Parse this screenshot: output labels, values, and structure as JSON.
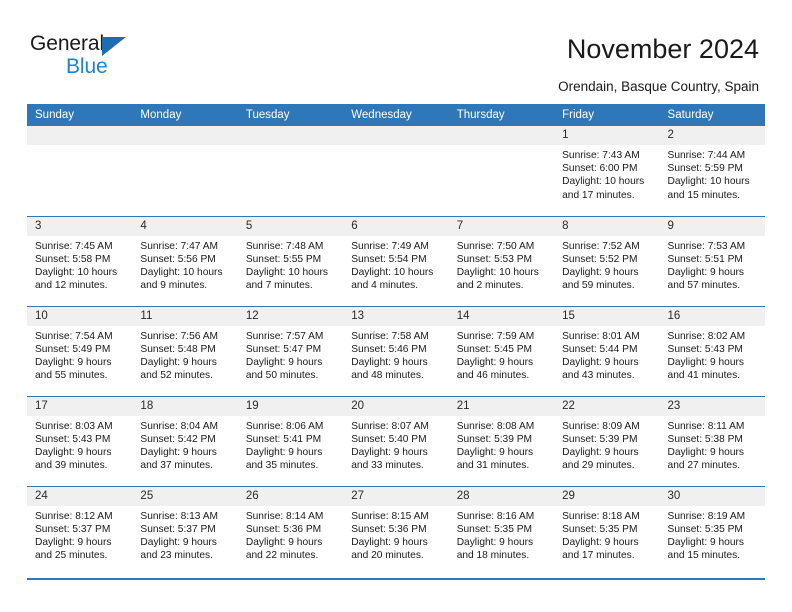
{
  "brand": {
    "name_part1": "General",
    "name_part2": "Blue",
    "triangle_color": "#1f6cb4",
    "blue_text_color": "#1f81d6"
  },
  "header": {
    "title": "November 2024",
    "location": "Orendain, Basque Country, Spain"
  },
  "theme": {
    "accent": "#2e77b8",
    "header_text": "#ffffff",
    "datenum_band": "#f0f0f0",
    "body_text": "#1a1a1a"
  },
  "weekday_headers": [
    "Sunday",
    "Monday",
    "Tuesday",
    "Wednesday",
    "Thursday",
    "Friday",
    "Saturday"
  ],
  "labels": {
    "sunrise_prefix": "Sunrise:",
    "sunset_prefix": "Sunset:",
    "daylight_prefix": "Daylight:"
  },
  "weeks": [
    [
      {
        "empty": true
      },
      {
        "empty": true
      },
      {
        "empty": true
      },
      {
        "empty": true
      },
      {
        "empty": true
      },
      {
        "day": "1",
        "line1": "Sunrise: 7:43 AM",
        "line2": "Sunset: 6:00 PM",
        "line3": "Daylight: 10 hours",
        "line4": "and 17 minutes."
      },
      {
        "day": "2",
        "line1": "Sunrise: 7:44 AM",
        "line2": "Sunset: 5:59 PM",
        "line3": "Daylight: 10 hours",
        "line4": "and 15 minutes."
      }
    ],
    [
      {
        "day": "3",
        "line1": "Sunrise: 7:45 AM",
        "line2": "Sunset: 5:58 PM",
        "line3": "Daylight: 10 hours",
        "line4": "and 12 minutes."
      },
      {
        "day": "4",
        "line1": "Sunrise: 7:47 AM",
        "line2": "Sunset: 5:56 PM",
        "line3": "Daylight: 10 hours",
        "line4": "and 9 minutes."
      },
      {
        "day": "5",
        "line1": "Sunrise: 7:48 AM",
        "line2": "Sunset: 5:55 PM",
        "line3": "Daylight: 10 hours",
        "line4": "and 7 minutes."
      },
      {
        "day": "6",
        "line1": "Sunrise: 7:49 AM",
        "line2": "Sunset: 5:54 PM",
        "line3": "Daylight: 10 hours",
        "line4": "and 4 minutes."
      },
      {
        "day": "7",
        "line1": "Sunrise: 7:50 AM",
        "line2": "Sunset: 5:53 PM",
        "line3": "Daylight: 10 hours",
        "line4": "and 2 minutes."
      },
      {
        "day": "8",
        "line1": "Sunrise: 7:52 AM",
        "line2": "Sunset: 5:52 PM",
        "line3": "Daylight: 9 hours",
        "line4": "and 59 minutes."
      },
      {
        "day": "9",
        "line1": "Sunrise: 7:53 AM",
        "line2": "Sunset: 5:51 PM",
        "line3": "Daylight: 9 hours",
        "line4": "and 57 minutes."
      }
    ],
    [
      {
        "day": "10",
        "line1": "Sunrise: 7:54 AM",
        "line2": "Sunset: 5:49 PM",
        "line3": "Daylight: 9 hours",
        "line4": "and 55 minutes."
      },
      {
        "day": "11",
        "line1": "Sunrise: 7:56 AM",
        "line2": "Sunset: 5:48 PM",
        "line3": "Daylight: 9 hours",
        "line4": "and 52 minutes."
      },
      {
        "day": "12",
        "line1": "Sunrise: 7:57 AM",
        "line2": "Sunset: 5:47 PM",
        "line3": "Daylight: 9 hours",
        "line4": "and 50 minutes."
      },
      {
        "day": "13",
        "line1": "Sunrise: 7:58 AM",
        "line2": "Sunset: 5:46 PM",
        "line3": "Daylight: 9 hours",
        "line4": "and 48 minutes."
      },
      {
        "day": "14",
        "line1": "Sunrise: 7:59 AM",
        "line2": "Sunset: 5:45 PM",
        "line3": "Daylight: 9 hours",
        "line4": "and 46 minutes."
      },
      {
        "day": "15",
        "line1": "Sunrise: 8:01 AM",
        "line2": "Sunset: 5:44 PM",
        "line3": "Daylight: 9 hours",
        "line4": "and 43 minutes."
      },
      {
        "day": "16",
        "line1": "Sunrise: 8:02 AM",
        "line2": "Sunset: 5:43 PM",
        "line3": "Daylight: 9 hours",
        "line4": "and 41 minutes."
      }
    ],
    [
      {
        "day": "17",
        "line1": "Sunrise: 8:03 AM",
        "line2": "Sunset: 5:43 PM",
        "line3": "Daylight: 9 hours",
        "line4": "and 39 minutes."
      },
      {
        "day": "18",
        "line1": "Sunrise: 8:04 AM",
        "line2": "Sunset: 5:42 PM",
        "line3": "Daylight: 9 hours",
        "line4": "and 37 minutes."
      },
      {
        "day": "19",
        "line1": "Sunrise: 8:06 AM",
        "line2": "Sunset: 5:41 PM",
        "line3": "Daylight: 9 hours",
        "line4": "and 35 minutes."
      },
      {
        "day": "20",
        "line1": "Sunrise: 8:07 AM",
        "line2": "Sunset: 5:40 PM",
        "line3": "Daylight: 9 hours",
        "line4": "and 33 minutes."
      },
      {
        "day": "21",
        "line1": "Sunrise: 8:08 AM",
        "line2": "Sunset: 5:39 PM",
        "line3": "Daylight: 9 hours",
        "line4": "and 31 minutes."
      },
      {
        "day": "22",
        "line1": "Sunrise: 8:09 AM",
        "line2": "Sunset: 5:39 PM",
        "line3": "Daylight: 9 hours",
        "line4": "and 29 minutes."
      },
      {
        "day": "23",
        "line1": "Sunrise: 8:11 AM",
        "line2": "Sunset: 5:38 PM",
        "line3": "Daylight: 9 hours",
        "line4": "and 27 minutes."
      }
    ],
    [
      {
        "day": "24",
        "line1": "Sunrise: 8:12 AM",
        "line2": "Sunset: 5:37 PM",
        "line3": "Daylight: 9 hours",
        "line4": "and 25 minutes."
      },
      {
        "day": "25",
        "line1": "Sunrise: 8:13 AM",
        "line2": "Sunset: 5:37 PM",
        "line3": "Daylight: 9 hours",
        "line4": "and 23 minutes."
      },
      {
        "day": "26",
        "line1": "Sunrise: 8:14 AM",
        "line2": "Sunset: 5:36 PM",
        "line3": "Daylight: 9 hours",
        "line4": "and 22 minutes."
      },
      {
        "day": "27",
        "line1": "Sunrise: 8:15 AM",
        "line2": "Sunset: 5:36 PM",
        "line3": "Daylight: 9 hours",
        "line4": "and 20 minutes."
      },
      {
        "day": "28",
        "line1": "Sunrise: 8:16 AM",
        "line2": "Sunset: 5:35 PM",
        "line3": "Daylight: 9 hours",
        "line4": "and 18 minutes."
      },
      {
        "day": "29",
        "line1": "Sunrise: 8:18 AM",
        "line2": "Sunset: 5:35 PM",
        "line3": "Daylight: 9 hours",
        "line4": "and 17 minutes."
      },
      {
        "day": "30",
        "line1": "Sunrise: 8:19 AM",
        "line2": "Sunset: 5:35 PM",
        "line3": "Daylight: 9 hours",
        "line4": "and 15 minutes."
      }
    ]
  ]
}
